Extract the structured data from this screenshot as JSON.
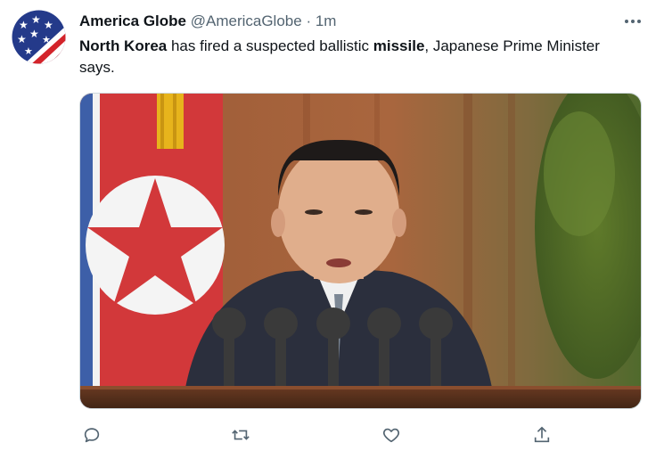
{
  "tweet": {
    "author_name": "America Globe",
    "handle": "@AmericaGlobe",
    "separator": "·",
    "time": "1m",
    "text_parts": {
      "bold1": "North Korea",
      "mid1": " has fired a suspected ballistic ",
      "bold2": "missile",
      "mid2": ", Japanese Prime Minister says."
    }
  },
  "icons": {
    "more": "more-horizontal-icon",
    "reply": "reply-icon",
    "retweet": "retweet-icon",
    "like": "heart-icon",
    "share": "share-icon"
  },
  "colors": {
    "text": "#0f1419",
    "secondary": "#536471",
    "border": "#cfd9de"
  }
}
